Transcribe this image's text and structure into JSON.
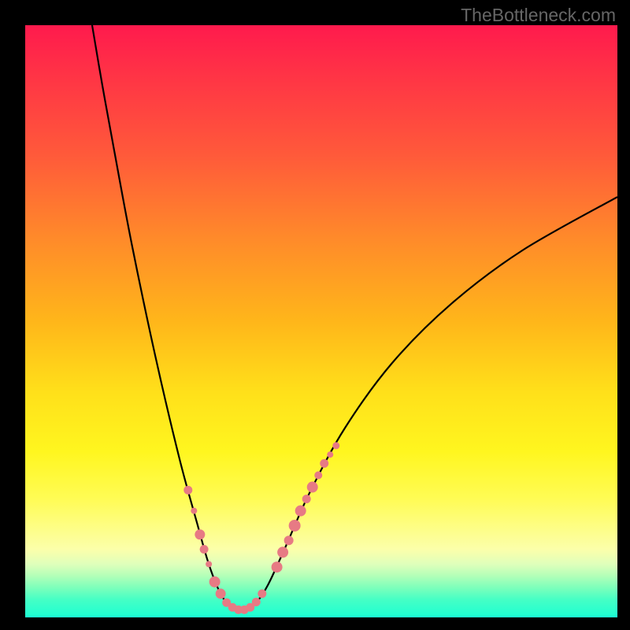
{
  "watermark": "TheBottleneck.com",
  "chart_data": {
    "type": "line",
    "title": "",
    "xlabel": "",
    "ylabel": "",
    "xlim": [
      0,
      100
    ],
    "ylim": [
      0,
      100
    ],
    "grid": false,
    "background": "vertical-gradient red→orange→yellow→green (top→bottom)",
    "series": [
      {
        "name": "bottleneck-curve",
        "kind": "smooth-curve",
        "points": [
          {
            "x": 11.3,
            "y": 100.0
          },
          {
            "x": 13.0,
            "y": 90.0
          },
          {
            "x": 15.0,
            "y": 79.0
          },
          {
            "x": 18.0,
            "y": 63.0
          },
          {
            "x": 22.0,
            "y": 44.0
          },
          {
            "x": 26.0,
            "y": 27.0
          },
          {
            "x": 29.0,
            "y": 16.0
          },
          {
            "x": 31.0,
            "y": 9.0
          },
          {
            "x": 33.0,
            "y": 4.0
          },
          {
            "x": 35.0,
            "y": 1.5
          },
          {
            "x": 37.0,
            "y": 1.2
          },
          {
            "x": 39.0,
            "y": 2.5
          },
          {
            "x": 41.0,
            "y": 5.5
          },
          {
            "x": 44.0,
            "y": 12.0
          },
          {
            "x": 48.0,
            "y": 21.0
          },
          {
            "x": 54.0,
            "y": 32.0
          },
          {
            "x": 62.0,
            "y": 43.0
          },
          {
            "x": 72.0,
            "y": 53.0
          },
          {
            "x": 84.0,
            "y": 62.0
          },
          {
            "x": 100.0,
            "y": 71.0
          }
        ]
      },
      {
        "name": "left-markers",
        "kind": "scatter",
        "color": "#e77a84",
        "points": [
          {
            "x": 27.5,
            "y": 21.5,
            "r": 5.5
          },
          {
            "x": 28.5,
            "y": 18.0,
            "r": 4.0
          },
          {
            "x": 29.5,
            "y": 14.0,
            "r": 6.5
          },
          {
            "x": 30.2,
            "y": 11.5,
            "r": 5.5
          },
          {
            "x": 31.0,
            "y": 9.0,
            "r": 4.0
          },
          {
            "x": 32.0,
            "y": 6.0,
            "r": 7.0
          },
          {
            "x": 33.0,
            "y": 4.0,
            "r": 6.5
          },
          {
            "x": 34.0,
            "y": 2.5,
            "r": 5.5
          },
          {
            "x": 35.0,
            "y": 1.7,
            "r": 5.5
          },
          {
            "x": 36.0,
            "y": 1.3,
            "r": 5.5
          },
          {
            "x": 37.0,
            "y": 1.3,
            "r": 5.5
          },
          {
            "x": 38.0,
            "y": 1.7,
            "r": 5.5
          },
          {
            "x": 39.0,
            "y": 2.6,
            "r": 5.5
          },
          {
            "x": 40.0,
            "y": 4.0,
            "r": 5.5
          }
        ]
      },
      {
        "name": "right-markers",
        "kind": "scatter",
        "color": "#e77a84",
        "points": [
          {
            "x": 42.5,
            "y": 8.5,
            "r": 7.0
          },
          {
            "x": 43.5,
            "y": 11.0,
            "r": 7.0
          },
          {
            "x": 44.5,
            "y": 13.0,
            "r": 6.0
          },
          {
            "x": 45.5,
            "y": 15.5,
            "r": 7.5
          },
          {
            "x": 46.5,
            "y": 18.0,
            "r": 7.0
          },
          {
            "x": 47.5,
            "y": 20.0,
            "r": 5.5
          },
          {
            "x": 48.5,
            "y": 22.0,
            "r": 7.0
          },
          {
            "x": 49.5,
            "y": 24.0,
            "r": 5.0
          },
          {
            "x": 50.5,
            "y": 26.0,
            "r": 5.5
          },
          {
            "x": 51.5,
            "y": 27.5,
            "r": 4.0
          },
          {
            "x": 52.5,
            "y": 29.0,
            "r": 4.5
          }
        ]
      }
    ]
  }
}
